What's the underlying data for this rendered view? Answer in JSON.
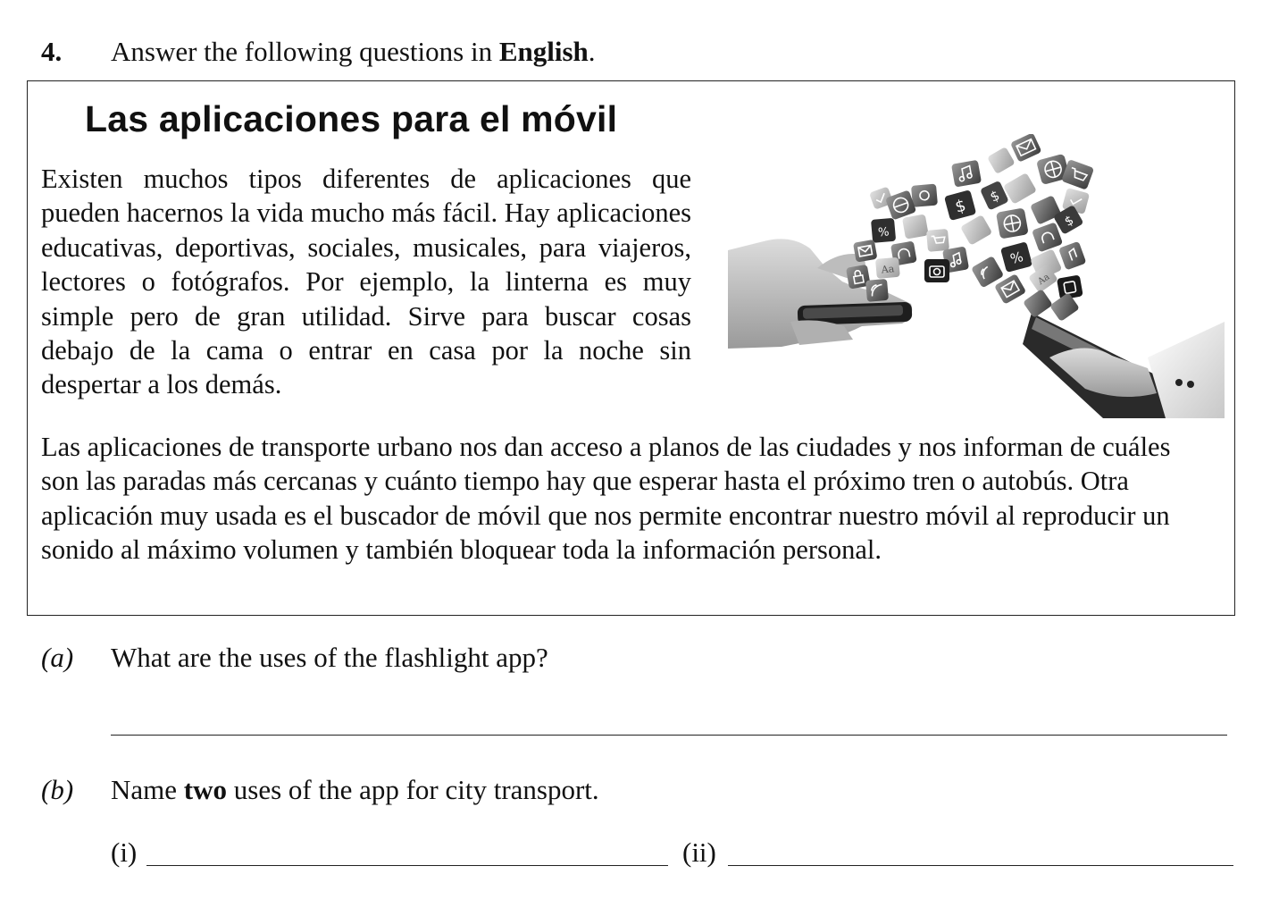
{
  "question": {
    "number": "4.",
    "instruction_pre": "Answer the following questions in ",
    "instruction_bold": "English",
    "instruction_post": "."
  },
  "article": {
    "title": "Las aplicaciones para el móvil",
    "paragraph1": "Existen muchos tipos diferentes de aplicaciones que pueden hacernos la vida mucho más fácil. Hay aplicaciones educativas, deportivas, sociales, musicales, para viajeros, lectores o fotógrafos. Por ejemplo, la linterna es muy simple pero de gran utilidad.  Sirve para buscar cosas debajo de la cama o entrar en casa por la noche sin despertar a los demás.",
    "paragraph2": "Las aplicaciones de transporte urbano nos dan acceso a planos de las ciudades y nos informan de cuáles son las paradas más cercanas y cuánto tiempo hay que esperar hasta el próximo tren o autobús. Otra aplicación muy usada es el buscador de móvil que nos permite encontrar nuestro móvil al reproducir un sonido al máximo volumen y también bloquear toda la información personal.",
    "image_icons": [
      "envelope-icon",
      "music-note-icon",
      "globe-icon",
      "cart-icon",
      "check-icon",
      "gear-icon",
      "dollar-icon",
      "percent-icon",
      "headphones-icon",
      "camera-icon",
      "rss-icon",
      "lock-icon",
      "font-icon"
    ]
  },
  "subquestions": {
    "a": {
      "label": "(a)",
      "text": "What are the uses of the flashlight app?"
    },
    "b": {
      "label": "(b)",
      "text_pre": "Name ",
      "text_bold": "two",
      "text_post": " uses of the app for city transport."
    },
    "b_parts": {
      "i": "(i)",
      "ii": "(ii)"
    }
  }
}
